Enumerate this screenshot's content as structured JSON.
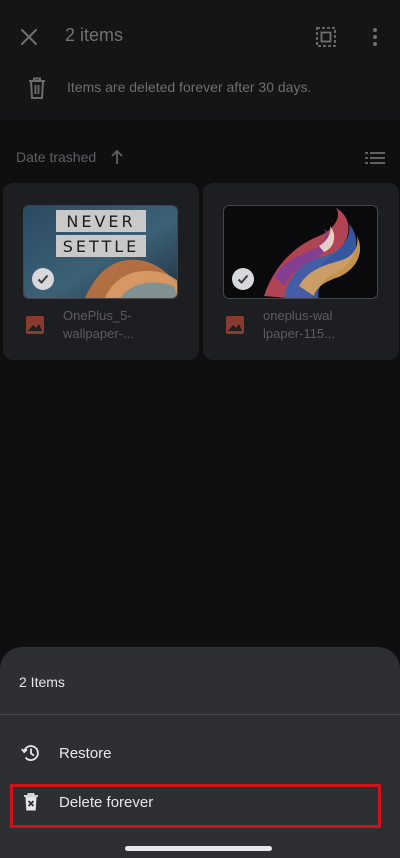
{
  "header": {
    "title": "2 items",
    "close_icon": "close-icon",
    "select_all_icon": "select-all-icon",
    "more_icon": "more-vert-icon"
  },
  "info": {
    "icon": "trash-icon",
    "text": "Items are deleted forever after 30 days."
  },
  "sort": {
    "label": "Date trashed",
    "direction_icon": "arrow-up-icon",
    "view_icon": "list-view-icon"
  },
  "items": [
    {
      "filename": "OnePlus_5-wallpaper-...",
      "line1": "OnePlus_5-",
      "line2": "wallpaper-...",
      "thumb_text_top": "NEVER",
      "thumb_text_bottom": "SETTLE",
      "selected": true
    },
    {
      "filename": "oneplus-wallpaper-115...",
      "line1": "oneplus-wal",
      "line2": "lpaper-115...",
      "selected": true
    }
  ],
  "sheet": {
    "title": "2 Items",
    "actions": [
      {
        "label": "Restore",
        "icon": "restore-icon"
      },
      {
        "label": "Delete forever",
        "icon": "delete-forever-icon",
        "highlighted": true
      }
    ]
  },
  "colors": {
    "background": "#0f0f10",
    "sheet": "#2e2f33",
    "highlight": "#d0121b",
    "image_icon": "#8a3b2f"
  }
}
